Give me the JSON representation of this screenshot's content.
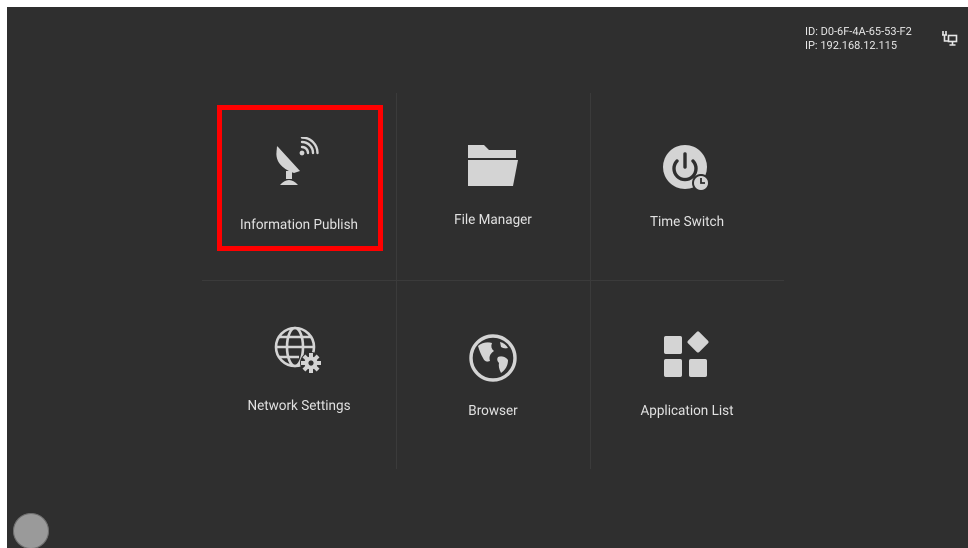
{
  "device": {
    "id_text": "ID: D0-6F-4A-65-53-F2",
    "ip_text": "IP: 192.168.12.115",
    "network_icon": "ethernet-icon"
  },
  "tiles": [
    {
      "label": "Information Publish",
      "icon": "satellite-dish-icon",
      "selected": true
    },
    {
      "label": "File Manager",
      "icon": "folder-icon",
      "selected": false
    },
    {
      "label": "Time Switch",
      "icon": "power-clock-icon",
      "selected": false
    },
    {
      "label": "Network Settings",
      "icon": "globe-gear-icon",
      "selected": false
    },
    {
      "label": "Browser",
      "icon": "globe-icon",
      "selected": false
    },
    {
      "label": "Application List",
      "icon": "app-grid-icon",
      "selected": false
    }
  ],
  "colors": {
    "background": "#2f2f2f",
    "selection": "#ff0000",
    "icon": "#d4d4d4",
    "text": "#e2e2e2"
  }
}
